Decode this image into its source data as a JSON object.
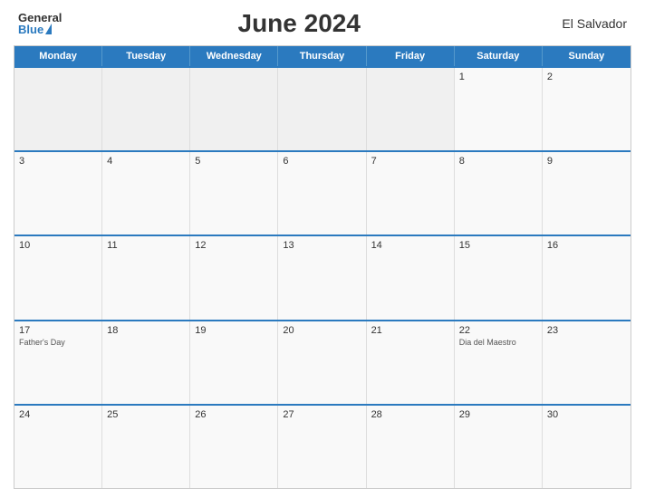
{
  "header": {
    "logo_general": "General",
    "logo_blue": "Blue",
    "title": "June 2024",
    "country": "El Salvador"
  },
  "days_of_week": [
    "Monday",
    "Tuesday",
    "Wednesday",
    "Thursday",
    "Friday",
    "Saturday",
    "Sunday"
  ],
  "weeks": [
    [
      {
        "num": "",
        "holiday": "",
        "empty": true
      },
      {
        "num": "",
        "holiday": "",
        "empty": true
      },
      {
        "num": "",
        "holiday": "",
        "empty": true
      },
      {
        "num": "",
        "holiday": "",
        "empty": true
      },
      {
        "num": "",
        "holiday": "",
        "empty": true
      },
      {
        "num": "1",
        "holiday": ""
      },
      {
        "num": "2",
        "holiday": ""
      }
    ],
    [
      {
        "num": "3",
        "holiday": ""
      },
      {
        "num": "4",
        "holiday": ""
      },
      {
        "num": "5",
        "holiday": ""
      },
      {
        "num": "6",
        "holiday": ""
      },
      {
        "num": "7",
        "holiday": ""
      },
      {
        "num": "8",
        "holiday": ""
      },
      {
        "num": "9",
        "holiday": ""
      }
    ],
    [
      {
        "num": "10",
        "holiday": ""
      },
      {
        "num": "11",
        "holiday": ""
      },
      {
        "num": "12",
        "holiday": ""
      },
      {
        "num": "13",
        "holiday": ""
      },
      {
        "num": "14",
        "holiday": ""
      },
      {
        "num": "15",
        "holiday": ""
      },
      {
        "num": "16",
        "holiday": ""
      }
    ],
    [
      {
        "num": "17",
        "holiday": "Father's Day"
      },
      {
        "num": "18",
        "holiday": ""
      },
      {
        "num": "19",
        "holiday": ""
      },
      {
        "num": "20",
        "holiday": ""
      },
      {
        "num": "21",
        "holiday": ""
      },
      {
        "num": "22",
        "holiday": "Dia del Maestro"
      },
      {
        "num": "23",
        "holiday": ""
      }
    ],
    [
      {
        "num": "24",
        "holiday": ""
      },
      {
        "num": "25",
        "holiday": ""
      },
      {
        "num": "26",
        "holiday": ""
      },
      {
        "num": "27",
        "holiday": ""
      },
      {
        "num": "28",
        "holiday": ""
      },
      {
        "num": "29",
        "holiday": ""
      },
      {
        "num": "30",
        "holiday": ""
      }
    ]
  ]
}
